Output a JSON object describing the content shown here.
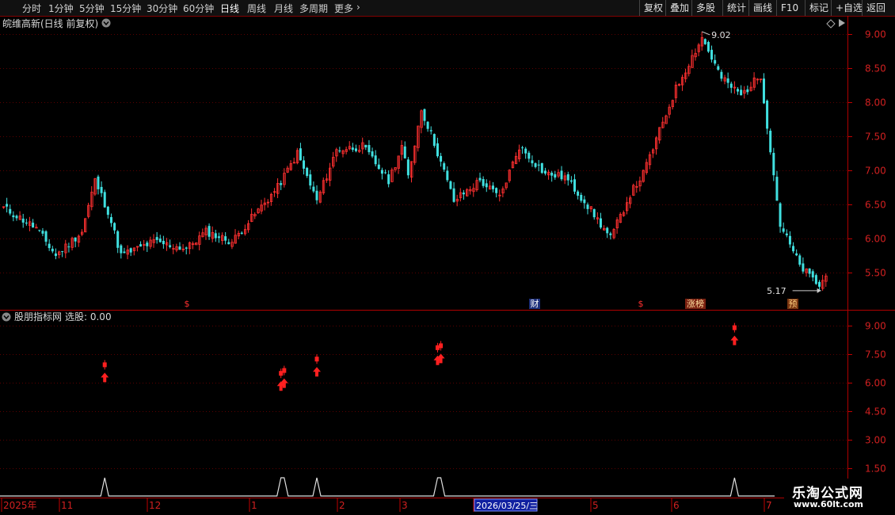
{
  "toolbar": {
    "periods": [
      "分时",
      "1分钟",
      "5分钟",
      "15分钟",
      "30分钟",
      "60分钟",
      "日线",
      "周线",
      "月线",
      "多周期",
      "更多"
    ],
    "active_period": "日线",
    "right_buttons": [
      "复权",
      "叠加",
      "多股",
      "统计",
      "画线",
      "F10",
      "标记",
      "+自选",
      "返回"
    ]
  },
  "main_panel": {
    "title": "皖维高新(日线 前复权)"
  },
  "indicator_panel": {
    "title": "股朋指标网",
    "value_label": "选股: 0.00"
  },
  "watermark": {
    "line1": "乐淘公式网",
    "line2": "www.60lt.com"
  },
  "chart_data": [
    {
      "type": "candlestick",
      "title": "皖维高新(日线 前复权)",
      "y_ticks": [
        9.0,
        8.5,
        8.0,
        7.5,
        7.0,
        6.5,
        6.0,
        5.5
      ],
      "ylim": [
        5.05,
        9.15
      ],
      "annotations": {
        "high": "9.02",
        "low": "5.17"
      },
      "event_marks": [
        "$",
        "财",
        "$",
        "涨榜",
        "预"
      ],
      "x_labels": [
        "2025年",
        "11",
        "12",
        "1",
        "2",
        "3",
        "2026/03/25/三",
        "5",
        "6",
        "7"
      ],
      "waypoints": [
        {
          "i": 0,
          "v": 6.45
        },
        {
          "i": 10,
          "v": 6.15
        },
        {
          "i": 16,
          "v": 5.75
        },
        {
          "i": 24,
          "v": 6.1
        },
        {
          "i": 28,
          "v": 6.85
        },
        {
          "i": 32,
          "v": 6.4
        },
        {
          "i": 36,
          "v": 5.75
        },
        {
          "i": 46,
          "v": 5.95
        },
        {
          "i": 56,
          "v": 5.85
        },
        {
          "i": 62,
          "v": 6.1
        },
        {
          "i": 70,
          "v": 5.95
        },
        {
          "i": 76,
          "v": 6.3
        },
        {
          "i": 84,
          "v": 6.75
        },
        {
          "i": 90,
          "v": 7.25
        },
        {
          "i": 96,
          "v": 6.55
        },
        {
          "i": 102,
          "v": 7.3
        },
        {
          "i": 110,
          "v": 7.35
        },
        {
          "i": 118,
          "v": 6.85
        },
        {
          "i": 122,
          "v": 7.35
        },
        {
          "i": 124,
          "v": 6.9
        },
        {
          "i": 128,
          "v": 7.9
        },
        {
          "i": 132,
          "v": 7.4
        },
        {
          "i": 138,
          "v": 6.55
        },
        {
          "i": 146,
          "v": 6.85
        },
        {
          "i": 152,
          "v": 6.6
        },
        {
          "i": 158,
          "v": 7.35
        },
        {
          "i": 166,
          "v": 6.95
        },
        {
          "i": 172,
          "v": 6.9
        },
        {
          "i": 178,
          "v": 6.55
        },
        {
          "i": 186,
          "v": 6.0
        },
        {
          "i": 192,
          "v": 6.65
        },
        {
          "i": 196,
          "v": 6.95
        },
        {
          "i": 206,
          "v": 8.2
        },
        {
          "i": 214,
          "v": 8.95
        },
        {
          "i": 220,
          "v": 8.35
        },
        {
          "i": 226,
          "v": 8.1
        },
        {
          "i": 232,
          "v": 8.4
        },
        {
          "i": 238,
          "v": 6.2
        },
        {
          "i": 244,
          "v": 5.6
        },
        {
          "i": 250,
          "v": 5.3
        },
        {
          "i": 252,
          "v": 5.45
        }
      ]
    },
    {
      "type": "scatter",
      "title": "股朋指标网",
      "y_ticks": [
        9.0,
        7.5,
        6.0,
        4.5,
        3.0,
        1.5
      ],
      "ylim": [
        1.2,
        9.8
      ],
      "signals": [
        {
          "i": 31,
          "v": 6.9
        },
        {
          "i": 85,
          "v": 6.45
        },
        {
          "i": 86,
          "v": 6.6
        },
        {
          "i": 96,
          "v": 7.2
        },
        {
          "i": 133,
          "v": 7.8
        },
        {
          "i": 134,
          "v": 7.9
        },
        {
          "i": 224,
          "v": 8.85
        }
      ]
    }
  ]
}
